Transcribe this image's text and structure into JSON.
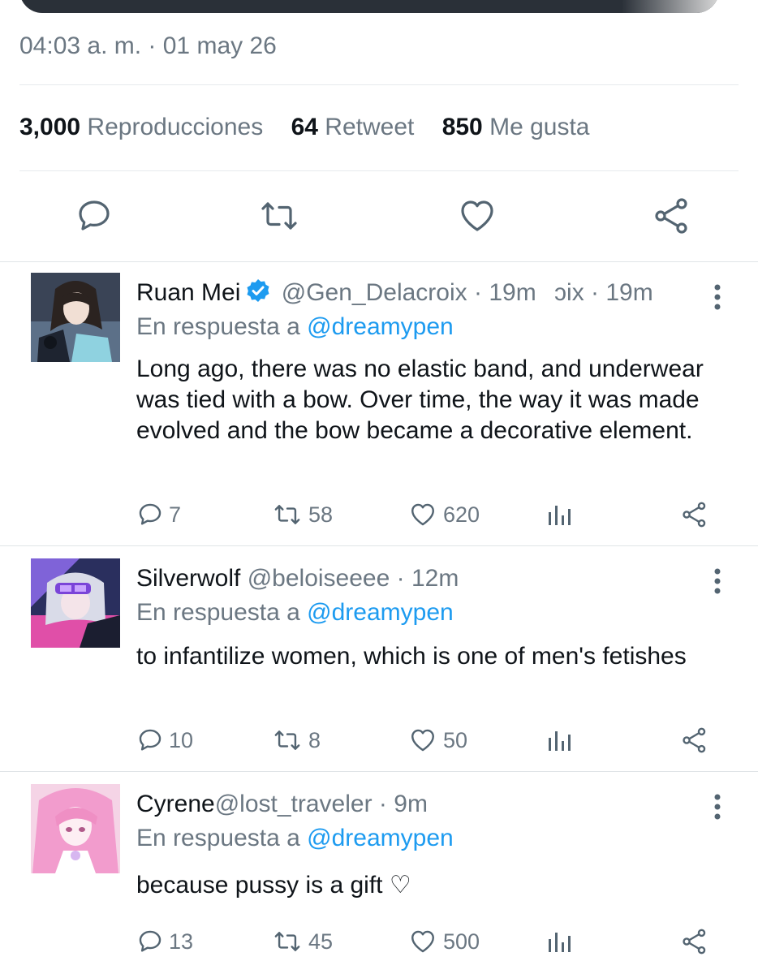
{
  "tweet": {
    "timestamp": "04:03 a. m. · 01 may 26",
    "stats": {
      "views_count": "3,000",
      "views_label": "Reproducciones",
      "retweets_count": "64",
      "retweets_label": "Retweet",
      "likes_count": "850",
      "likes_label": "Me gusta"
    },
    "action_icons": [
      "reply-icon",
      "retweet-icon",
      "like-icon",
      "share-icon"
    ]
  },
  "replies": [
    {
      "name": "Ruan Mei",
      "verified": true,
      "handle": "@Gen_Delacroix",
      "separator": "·",
      "time": "19m",
      "ghost_text": "ɔix · 19m",
      "reply_to_label": "En respuesta a",
      "reply_to_handle": "@dreamypen",
      "text": "Long ago, there was no elastic band, and underwear was tied with a bow. Over time, the way it was made evolved and the bow became a decorative element.",
      "replies": "7",
      "retweets": "58",
      "likes": "620"
    },
    {
      "name": "Silverwolf",
      "verified": false,
      "handle": "@beloiseeee",
      "separator": "·",
      "time": "12m",
      "reply_to_label": "En respuesta a",
      "reply_to_handle": "@dreamypen",
      "text": "to infantilize women, which is one of men's fetishes",
      "replies": "10",
      "retweets": "8",
      "likes": "50"
    },
    {
      "name": "Cyrene",
      "verified": false,
      "handle": "@lost_traveler",
      "separator": "·",
      "time": "9m",
      "reply_to_label": "En respuesta a",
      "reply_to_handle": "@dreamypen",
      "text": "because pussy is a gift ♡",
      "replies": "13",
      "retweets": "45",
      "likes": "500"
    }
  ],
  "colors": {
    "accent": "#1d9bf0",
    "muted": "#6b7782",
    "text": "#0f1419",
    "divider": "#e6eaed"
  }
}
